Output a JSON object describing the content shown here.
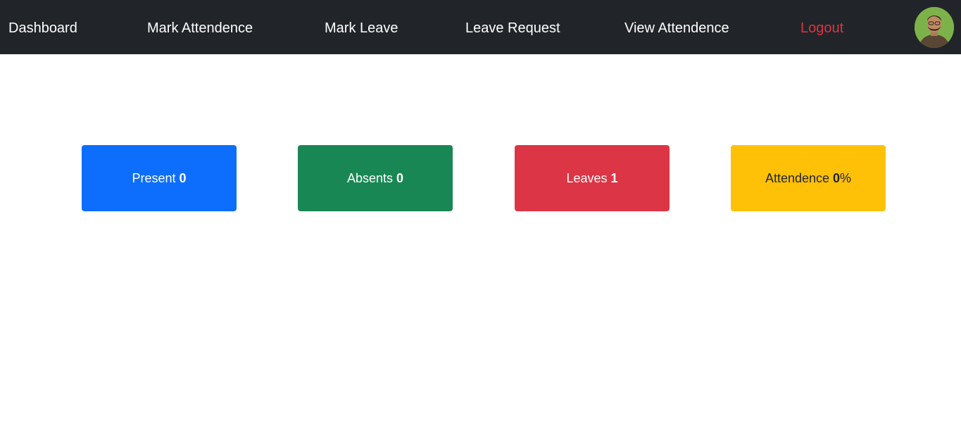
{
  "nav": {
    "items": [
      {
        "label": "Dashboard"
      },
      {
        "label": "Mark Attendence"
      },
      {
        "label": "Mark Leave"
      },
      {
        "label": "Leave Request"
      },
      {
        "label": "View Attendence"
      },
      {
        "label": "Logout"
      }
    ],
    "background_color": "#212529",
    "link_color": "#ffffff",
    "logout_color": "#dc3545"
  },
  "stats": [
    {
      "label": "Present",
      "value": "0",
      "suffix": "",
      "color": "#0d6efd"
    },
    {
      "label": "Absents",
      "value": "0",
      "suffix": "",
      "color": "#198754"
    },
    {
      "label": "Leaves",
      "value": "1",
      "suffix": "",
      "color": "#dc3545"
    },
    {
      "label": "Attendence",
      "value": "0",
      "suffix": "%",
      "color": "#ffc107"
    }
  ]
}
